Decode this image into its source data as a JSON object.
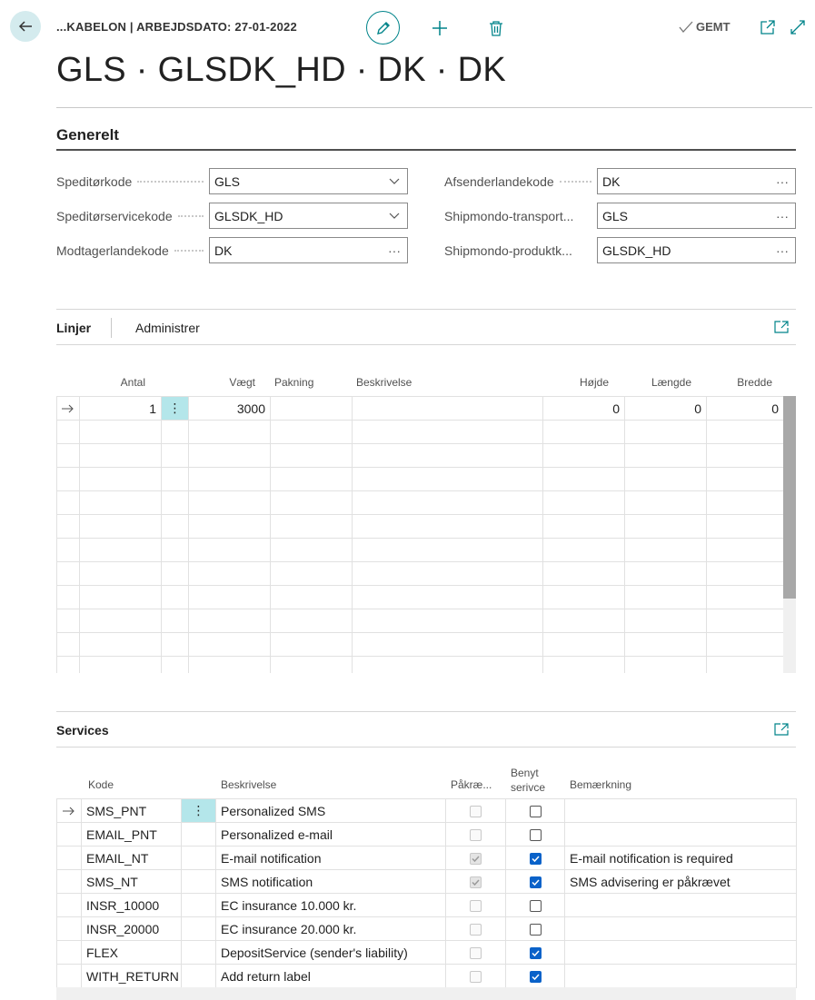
{
  "header": {
    "breadcrumb": "...KABELON | ARBEJDSDATO: 27-01-2022",
    "title": "GLS · GLSDK_HD · DK · DK",
    "saved_label": "GEMT"
  },
  "general": {
    "heading": "Generelt",
    "left_fields": [
      {
        "label": "Speditørkode",
        "value": "GLS",
        "control": "dropdown"
      },
      {
        "label": "Speditørservicekode",
        "value": "GLSDK_HD",
        "control": "dropdown"
      },
      {
        "label": "Modtagerlandekode",
        "value": "DK",
        "control": "lookup"
      }
    ],
    "right_fields": [
      {
        "label": "Afsenderlandekode",
        "value": "DK",
        "control": "lookup"
      },
      {
        "label": "Shipmondo-transport...",
        "value": "GLS",
        "control": "lookup"
      },
      {
        "label": "Shipmondo-produktk...",
        "value": "GLSDK_HD",
        "control": "lookup"
      }
    ]
  },
  "lines": {
    "tab_active": "Linjer",
    "tab_other": "Administrer",
    "columns": {
      "antal": "Antal",
      "vaegt": "Vægt",
      "pakning": "Pakning",
      "beskrivelse": "Beskrivelse",
      "hoejde": "Højde",
      "laengde": "Længde",
      "bredde": "Bredde"
    },
    "rows": [
      {
        "antal": "1",
        "vaegt": "3000",
        "pakning": "",
        "beskrivelse": "",
        "hoejde": "0",
        "laengde": "0",
        "bredde": "0"
      }
    ]
  },
  "services": {
    "heading": "Services",
    "columns": {
      "kode": "Kode",
      "beskrivelse": "Beskrivelse",
      "paakraevet": "Påkræ...",
      "benyt_line1": "Benyt",
      "benyt_line2": "serivce",
      "bemaerkning": "Bemærkning"
    },
    "rows": [
      {
        "kode": "SMS_PNT",
        "beskrivelse": "Personalized SMS",
        "required": false,
        "use": false,
        "remark": ""
      },
      {
        "kode": "EMAIL_PNT",
        "beskrivelse": "Personalized e-mail",
        "required": false,
        "use": false,
        "remark": ""
      },
      {
        "kode": "EMAIL_NT",
        "beskrivelse": "E-mail notification",
        "required": true,
        "use": true,
        "remark": "E-mail notification is required"
      },
      {
        "kode": "SMS_NT",
        "beskrivelse": "SMS notification",
        "required": true,
        "use": true,
        "remark": "SMS advisering er påkrævet"
      },
      {
        "kode": "INSR_10000",
        "beskrivelse": "EC insurance 10.000 kr.",
        "required": false,
        "use": false,
        "remark": ""
      },
      {
        "kode": "INSR_20000",
        "beskrivelse": "EC insurance 20.000 kr.",
        "required": false,
        "use": false,
        "remark": ""
      },
      {
        "kode": "FLEX",
        "beskrivelse": "DepositService (sender's liability)",
        "required": false,
        "use": true,
        "remark": ""
      },
      {
        "kode": "WITH_RETURN",
        "beskrivelse": "Add return label",
        "required": false,
        "use": true,
        "remark": ""
      }
    ]
  },
  "colors": {
    "accent": "#00848a",
    "checkbox_on": "#0a62c9",
    "selected_cell": "#b4e6ea"
  }
}
